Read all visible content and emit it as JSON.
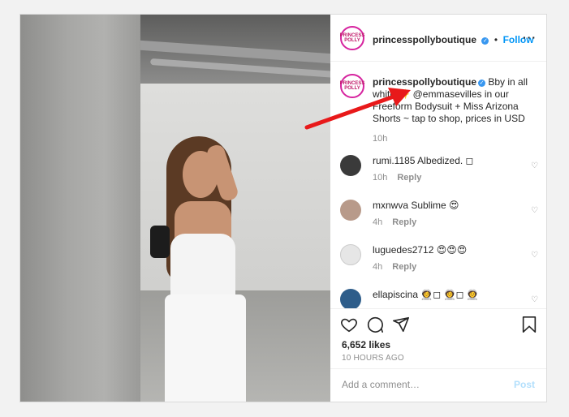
{
  "header": {
    "username": "princesspollyboutique",
    "separator": "•",
    "follow_label": "Follow",
    "more_icon": "more-horizontal-icon",
    "avatar_text": "PRINCESS POLLY"
  },
  "caption": {
    "username": "princesspollyboutique",
    "text": "Bby in all white ✨ @emmasevilles in our Freeform Bodysuit + Miss Arizona Shorts ~ tap to shop, prices in USD",
    "time": "10h"
  },
  "comments": [
    {
      "username": "rumi.1185",
      "text": "Albedized. ◻",
      "time": "10h",
      "reply_label": "Reply"
    },
    {
      "username": "mxnwva",
      "text": "Sublime 😍",
      "time": "4h",
      "reply_label": "Reply"
    },
    {
      "username": "luguedes2712",
      "text": "😍😍😍",
      "time": "4h",
      "reply_label": "Reply"
    },
    {
      "username": "ellapiscina",
      "text": "👩‍🚀◻ 👩‍🚀◻  👩‍🚀",
      "time": "",
      "reply_label": ""
    }
  ],
  "actions": {
    "like_icon": "heart-icon",
    "comment_icon": "comment-icon",
    "share_icon": "send-icon",
    "save_icon": "bookmark-icon",
    "likes": "6,652 likes",
    "timestamp": "10 HOURS AGO"
  },
  "add_comment": {
    "placeholder": "Add a comment…",
    "post_label": "Post"
  },
  "colors": {
    "accent": "#0095f6",
    "annotation_arrow": "#e8191a",
    "post_disabled": "#b2dffc"
  }
}
